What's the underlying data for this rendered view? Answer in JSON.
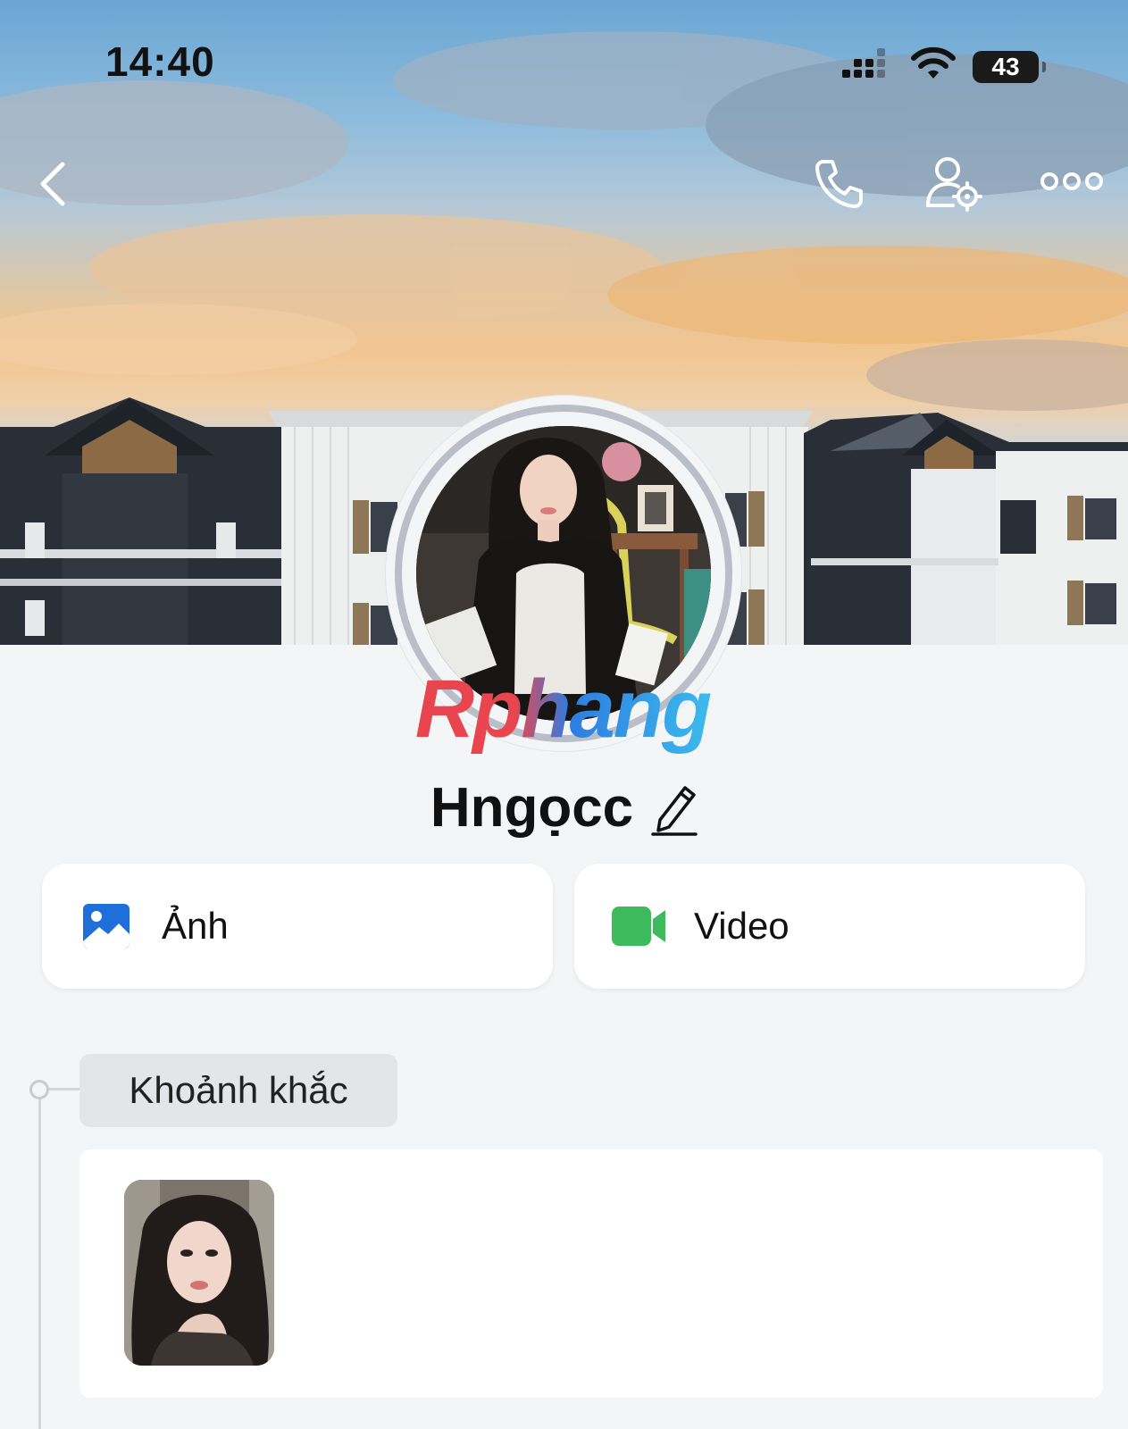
{
  "status_bar": {
    "time": "14:40",
    "battery": "43",
    "icons": [
      "cellular-signal-icon",
      "wifi-icon",
      "battery-icon"
    ]
  },
  "header": {
    "back_icon": "chevron-left-icon",
    "actions": [
      "phone-icon",
      "user-settings-icon",
      "more-icon"
    ]
  },
  "profile": {
    "name": "Hngọcc",
    "edit_icon": "pencil-icon",
    "watermark": "Rphang"
  },
  "media": {
    "photos_label": "Ảnh",
    "videos_label": "Video",
    "photos_icon": "image-icon",
    "videos_icon": "video-camera-icon",
    "photos_icon_color": "#1e6fd9",
    "videos_icon_color": "#3dba5c"
  },
  "moments": {
    "label": "Khoảnh khắc",
    "items_count": 1
  },
  "colors": {
    "background": "#f3f5f7",
    "card": "#ffffff",
    "tag": "#e3e5e8"
  }
}
